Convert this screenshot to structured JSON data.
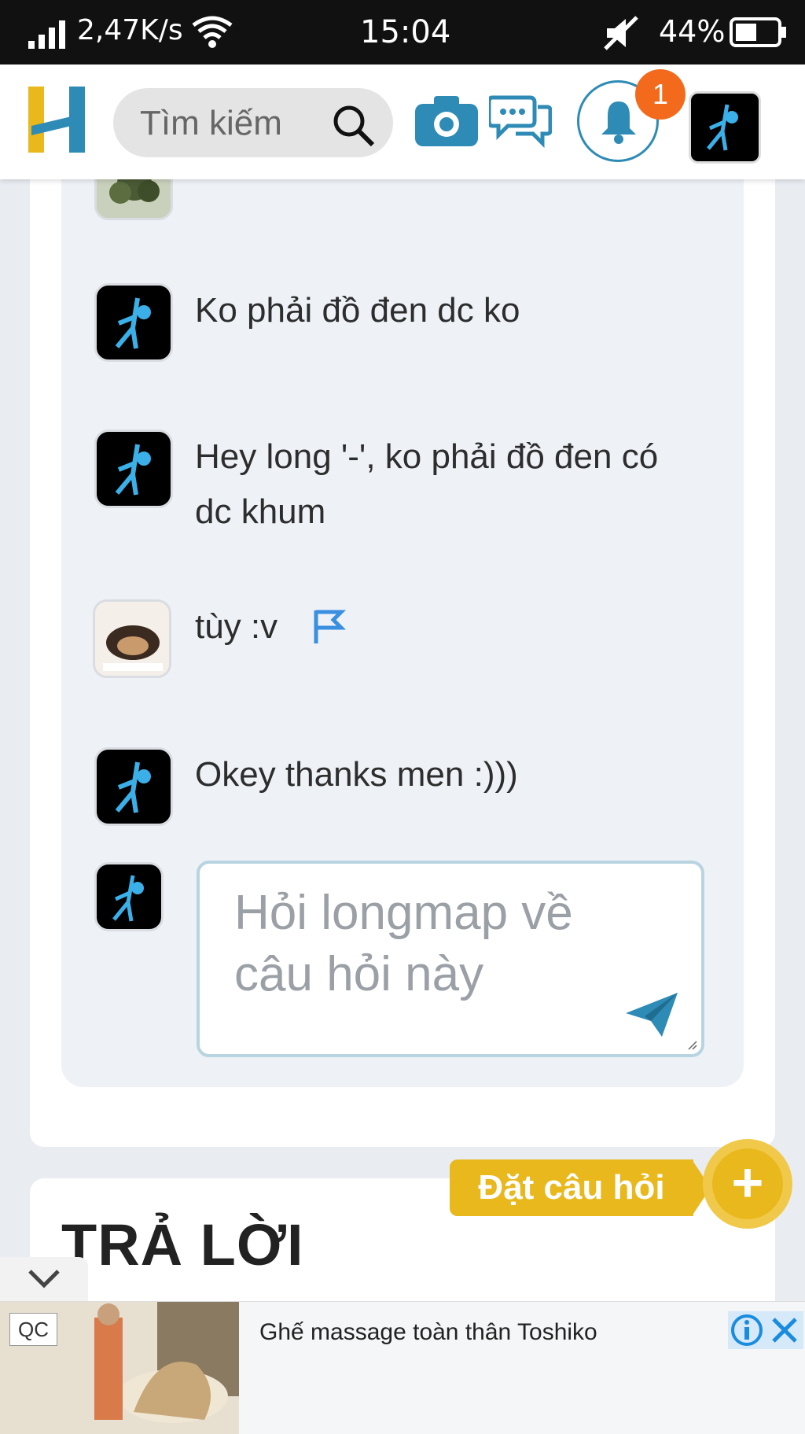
{
  "status_bar": {
    "net_speed": "2,47K/s",
    "time": "15:04",
    "battery": "44%"
  },
  "header": {
    "search_placeholder": "Tìm kiếm",
    "notification_count": "1"
  },
  "comments": [
    {
      "avatar": "plant",
      "text": ""
    },
    {
      "avatar": "stickman",
      "text": "Ko phải đồ đen dc ko"
    },
    {
      "avatar": "stickman",
      "text": "Hey long '-', ko phải đồ đen có dc khum"
    },
    {
      "avatar": "dog",
      "text": "tùy :v"
    },
    {
      "avatar": "stickman",
      "text": "Okey thanks men :)))"
    }
  ],
  "reply": {
    "placeholder": "Hỏi longmap về câu hỏi này"
  },
  "ask_button": {
    "label": "Đặt câu hỏi"
  },
  "answers": {
    "title": "TRẢ LỜI"
  },
  "ad": {
    "label": "QC",
    "text": "Ghế massage toàn thân Toshiko"
  },
  "colors": {
    "brand_blue": "#2e8bb5",
    "brand_yellow": "#e8b81c",
    "badge_orange": "#f36a1c"
  }
}
